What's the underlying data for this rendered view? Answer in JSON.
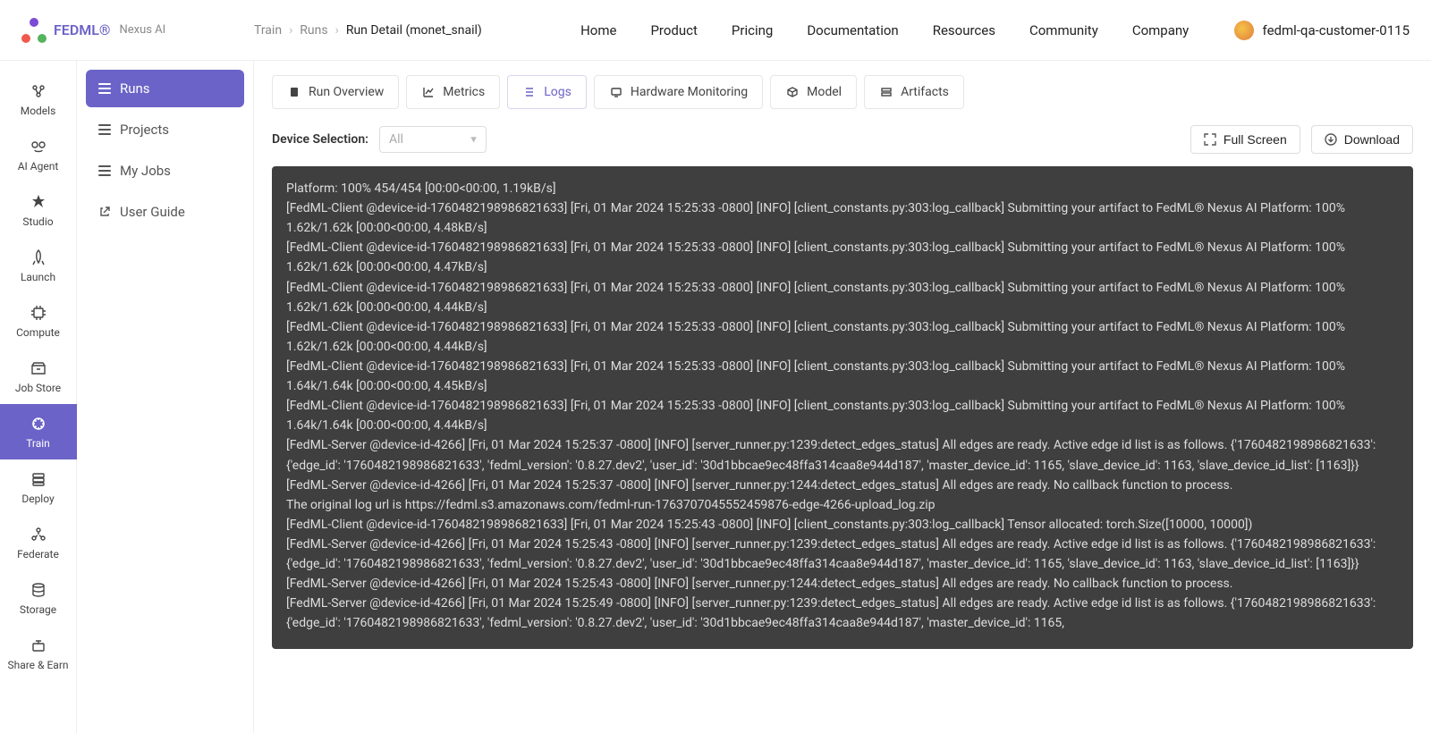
{
  "brand": {
    "name": "FEDML®",
    "suffix": "Nexus AI"
  },
  "breadcrumb": {
    "a": "Train",
    "b": "Runs",
    "c": "Run Detail (monet_snail)"
  },
  "topnav": [
    "Home",
    "Product",
    "Pricing",
    "Documentation",
    "Resources",
    "Community",
    "Company"
  ],
  "user": {
    "name": "fedml-qa-customer-0115"
  },
  "rail": [
    {
      "label": "Models",
      "name": "models"
    },
    {
      "label": "AI Agent",
      "name": "ai-agent"
    },
    {
      "label": "Studio",
      "name": "studio"
    },
    {
      "label": "Launch",
      "name": "launch"
    },
    {
      "label": "Compute",
      "name": "compute"
    },
    {
      "label": "Job Store",
      "name": "job-store"
    },
    {
      "label": "Train",
      "name": "train",
      "active": true
    },
    {
      "label": "Deploy",
      "name": "deploy"
    },
    {
      "label": "Federate",
      "name": "federate"
    },
    {
      "label": "Storage",
      "name": "storage"
    },
    {
      "label": "Share & Earn",
      "name": "share-earn"
    }
  ],
  "subnav": [
    {
      "label": "Runs",
      "active": true
    },
    {
      "label": "Projects"
    },
    {
      "label": "My Jobs"
    },
    {
      "label": "User Guide"
    }
  ],
  "tabs": [
    {
      "label": "Run Overview"
    },
    {
      "label": "Metrics"
    },
    {
      "label": "Logs",
      "active": true
    },
    {
      "label": "Hardware Monitoring"
    },
    {
      "label": "Model"
    },
    {
      "label": "Artifacts"
    }
  ],
  "toolbar": {
    "device_label": "Device Selection:",
    "device_value": "All",
    "fullscreen": "Full Screen",
    "download": "Download"
  },
  "logs": [
    "Platform: 100% 454/454 [00:00<00:00, 1.19kB/s]",
    "[FedML-Client @device-id-1760482198986821633] [Fri, 01 Mar 2024 15:25:33 -0800] [INFO] [client_constants.py:303:log_callback] Submitting your artifact to FedML® Nexus AI Platform: 100% 1.62k/1.62k [00:00<00:00, 4.48kB/s]",
    "[FedML-Client @device-id-1760482198986821633] [Fri, 01 Mar 2024 15:25:33 -0800] [INFO] [client_constants.py:303:log_callback] Submitting your artifact to FedML® Nexus AI Platform: 100% 1.62k/1.62k [00:00<00:00, 4.47kB/s]",
    "[FedML-Client @device-id-1760482198986821633] [Fri, 01 Mar 2024 15:25:33 -0800] [INFO] [client_constants.py:303:log_callback] Submitting your artifact to FedML® Nexus AI Platform: 100% 1.62k/1.62k [00:00<00:00, 4.44kB/s]",
    "[FedML-Client @device-id-1760482198986821633] [Fri, 01 Mar 2024 15:25:33 -0800] [INFO] [client_constants.py:303:log_callback] Submitting your artifact to FedML® Nexus AI Platform: 100% 1.62k/1.62k [00:00<00:00, 4.44kB/s]",
    "[FedML-Client @device-id-1760482198986821633] [Fri, 01 Mar 2024 15:25:33 -0800] [INFO] [client_constants.py:303:log_callback] Submitting your artifact to FedML® Nexus AI Platform: 100% 1.64k/1.64k [00:00<00:00, 4.45kB/s]",
    "[FedML-Client @device-id-1760482198986821633] [Fri, 01 Mar 2024 15:25:33 -0800] [INFO] [client_constants.py:303:log_callback] Submitting your artifact to FedML® Nexus AI Platform: 100% 1.64k/1.64k [00:00<00:00, 4.44kB/s]",
    "[FedML-Server @device-id-4266] [Fri, 01 Mar 2024 15:25:37 -0800] [INFO] [server_runner.py:1239:detect_edges_status] All edges are ready. Active edge id list is as follows. {'1760482198986821633': {'edge_id': '1760482198986821633', 'fedml_version': '0.8.27.dev2', 'user_id': '30d1bbcae9ec48ffa314caa8e944d187', 'master_device_id': 1165, 'slave_device_id': 1163, 'slave_device_id_list': [1163]}}",
    "[FedML-Server @device-id-4266] [Fri, 01 Mar 2024 15:25:37 -0800] [INFO] [server_runner.py:1244:detect_edges_status] All edges are ready. No callback function to process.",
    "The original log url is https://fedml.s3.amazonaws.com/fedml-run-1763707045552459876-edge-4266-upload_log.zip",
    "[FedML-Client @device-id-1760482198986821633] [Fri, 01 Mar 2024 15:25:43 -0800] [INFO] [client_constants.py:303:log_callback] Tensor allocated: torch.Size([10000, 10000])",
    "[FedML-Server @device-id-4266] [Fri, 01 Mar 2024 15:25:43 -0800] [INFO] [server_runner.py:1239:detect_edges_status] All edges are ready. Active edge id list is as follows. {'1760482198986821633': {'edge_id': '1760482198986821633', 'fedml_version': '0.8.27.dev2', 'user_id': '30d1bbcae9ec48ffa314caa8e944d187', 'master_device_id': 1165, 'slave_device_id': 1163, 'slave_device_id_list': [1163]}}",
    "[FedML-Server @device-id-4266] [Fri, 01 Mar 2024 15:25:43 -0800] [INFO] [server_runner.py:1244:detect_edges_status] All edges are ready. No callback function to process.",
    "[FedML-Server @device-id-4266] [Fri, 01 Mar 2024 15:25:49 -0800] [INFO] [server_runner.py:1239:detect_edges_status] All edges are ready. Active edge id list is as follows. {'1760482198986821633': {'edge_id': '1760482198986821633', 'fedml_version': '0.8.27.dev2', 'user_id': '30d1bbcae9ec48ffa314caa8e944d187', 'master_device_id': 1165,"
  ]
}
